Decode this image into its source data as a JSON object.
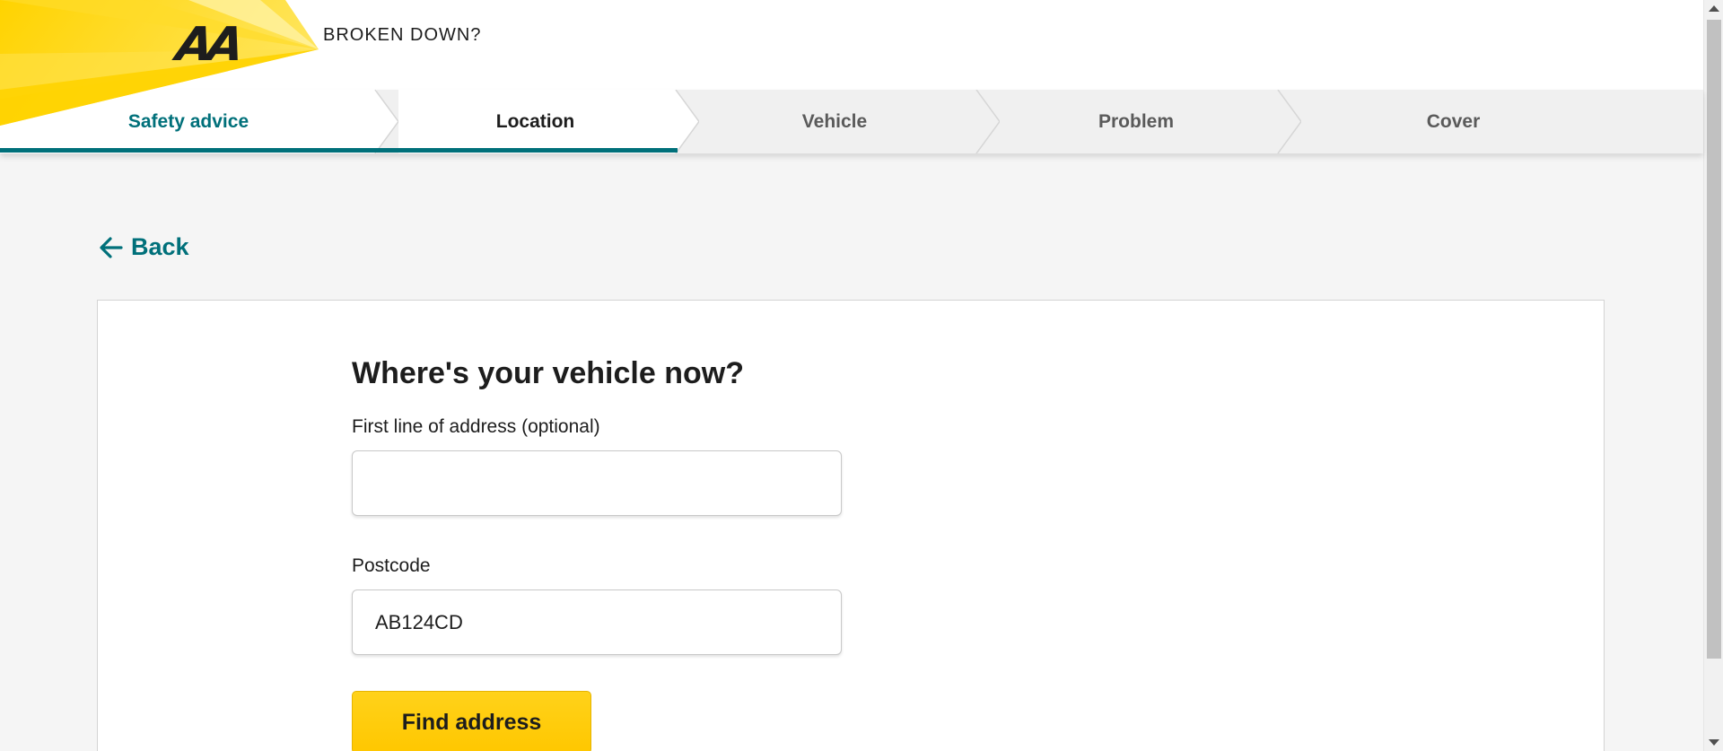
{
  "brand": {
    "logo_text": "AA",
    "tagline": "BROKEN DOWN?",
    "accent_yellow": "#ffd300",
    "accent_teal": "#00707a"
  },
  "progress": {
    "steps": [
      {
        "label": "Safety advice",
        "state": "done"
      },
      {
        "label": "Location",
        "state": "current"
      },
      {
        "label": "Vehicle",
        "state": "todo"
      },
      {
        "label": "Problem",
        "state": "todo"
      },
      {
        "label": "Cover",
        "state": "todo"
      }
    ]
  },
  "nav": {
    "back_label": "Back",
    "back_icon": "arrow-left-icon"
  },
  "form": {
    "title": "Where's your vehicle now?",
    "address_label": "First line of address (optional)",
    "address_value": "",
    "postcode_label": "Postcode",
    "postcode_value": "AB124CD",
    "find_button_label": "Find address"
  }
}
